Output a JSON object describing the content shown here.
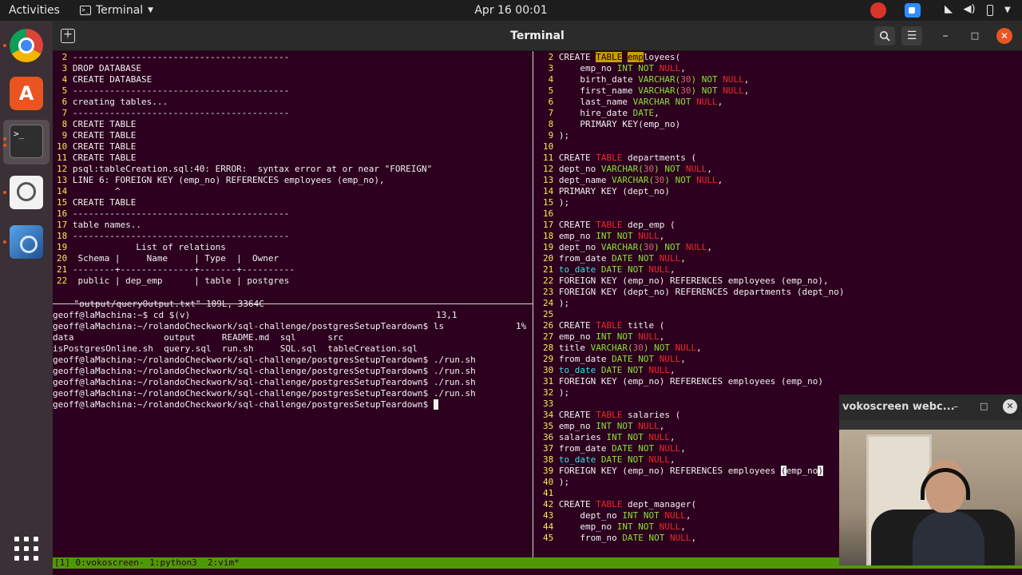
{
  "topbar": {
    "activities": "Activities",
    "app_menu": "Terminal",
    "clock": "Apr 16  00:01"
  },
  "window": {
    "title": "Terminal"
  },
  "colors": {
    "terminal_bg": "#2c001e",
    "line_number": "#fce94f",
    "keyword": "#ef2929",
    "type": "#8ae234",
    "ubuntu_orange": "#e95420",
    "tmux_bar": "#4e9a06"
  },
  "left_vim": {
    "lines": [
      {
        "n": " 2",
        "t": " -----------------------------------------"
      },
      {
        "n": " 3",
        "t": " DROP DATABASE"
      },
      {
        "n": " 4",
        "t": " CREATE DATABASE"
      },
      {
        "n": " 5",
        "t": " -----------------------------------------"
      },
      {
        "n": " 6",
        "t": " creating tables..."
      },
      {
        "n": " 7",
        "t": " -----------------------------------------"
      },
      {
        "n": " 8",
        "t": " CREATE TABLE"
      },
      {
        "n": " 9",
        "t": " CREATE TABLE"
      },
      {
        "n": "10",
        "t": " CREATE TABLE"
      },
      {
        "n": "11",
        "t": " CREATE TABLE"
      },
      {
        "n": "12",
        "t": " psql:tableCreation.sql:40: ERROR:  syntax error at or near \"FOREIGN\""
      },
      {
        "n": "13",
        "t": " LINE 6: FOREIGN KEY (emp_no) REFERENCES employees (emp_no),"
      },
      {
        "n": "14",
        "t": "         ^"
      },
      {
        "n": "15",
        "t": " CREATE TABLE"
      },
      {
        "n": "16",
        "t": " -----------------------------------------"
      },
      {
        "n": "17",
        "t": " table names.."
      },
      {
        "n": "18",
        "t": " -----------------------------------------"
      },
      {
        "n": "19",
        "t": "             List of relations"
      },
      {
        "n": "20",
        "t": "  Schema |     Name     | Type  |  Owner"
      },
      {
        "n": "21",
        "t": " --------+--------------+-------+----------"
      },
      {
        "n": "22",
        "t": "  public | dep_emp      | table | postgres"
      }
    ],
    "status_file": "\"output/queryOutput.txt\" 109L, 3364C",
    "status_pos": "13,1",
    "status_pct": "1%"
  },
  "shell": {
    "lines": [
      "geoff@laMachina:~$ cd $(v)",
      "geoff@laMachina:~/rolandoCheckwork/sql-challenge/postgresSetupTeardown$ ls",
      "data                 output     README.md  sql      src",
      "isPostgresOnline.sh  query.sql  run.sh     SQL.sql  tableCreation.sql",
      "geoff@laMachina:~/rolandoCheckwork/sql-challenge/postgresSetupTeardown$ ./run.sh",
      "geoff@laMachina:~/rolandoCheckwork/sql-challenge/postgresSetupTeardown$ ./run.sh",
      "geoff@laMachina:~/rolandoCheckwork/sql-challenge/postgresSetupTeardown$ ./run.sh",
      "geoff@laMachina:~/rolandoCheckwork/sql-challenge/postgresSetupTeardown$ ./run.sh",
      "geoff@laMachina:~/rolandoCheckwork/sql-challenge/postgresSetupTeardown$ "
    ]
  },
  "right_vim": {
    "lines": [
      {
        "n": " 2",
        "s": [
          [
            "kw2",
            "CREATE "
          ],
          [
            "hl",
            "TABLE"
          ],
          [
            "p",
            " "
          ],
          [
            "hl",
            "emp"
          ],
          [
            "p",
            "loyees("
          ]
        ]
      },
      {
        "n": " 3",
        "s": [
          [
            "p",
            "    emp_no "
          ],
          [
            "ty",
            "INT"
          ],
          [
            "p",
            " "
          ],
          [
            "ty",
            "NOT"
          ],
          [
            "p",
            " "
          ],
          [
            "kw",
            "NULL"
          ],
          [
            "p",
            ","
          ]
        ]
      },
      {
        "n": " 4",
        "s": [
          [
            "p",
            "    birth_date "
          ],
          [
            "ty",
            "VARCHAR("
          ],
          [
            "nm",
            "30"
          ],
          [
            "ty",
            ")"
          ],
          [
            "p",
            " "
          ],
          [
            "ty",
            "NOT"
          ],
          [
            "p",
            " "
          ],
          [
            "kw",
            "NULL"
          ],
          [
            "p",
            ","
          ]
        ]
      },
      {
        "n": " 5",
        "s": [
          [
            "p",
            "    first_name "
          ],
          [
            "ty",
            "VARCHAR("
          ],
          [
            "nm",
            "30"
          ],
          [
            "ty",
            ")"
          ],
          [
            "p",
            " "
          ],
          [
            "ty",
            "NOT"
          ],
          [
            "p",
            " "
          ],
          [
            "kw",
            "NULL"
          ],
          [
            "p",
            ","
          ]
        ]
      },
      {
        "n": " 6",
        "s": [
          [
            "p",
            "    last_name "
          ],
          [
            "ty",
            "VARCHAR"
          ],
          [
            "p",
            " "
          ],
          [
            "ty",
            "NOT"
          ],
          [
            "p",
            " "
          ],
          [
            "kw",
            "NULL"
          ],
          [
            "p",
            ","
          ]
        ]
      },
      {
        "n": " 7",
        "s": [
          [
            "p",
            "    hire_date "
          ],
          [
            "ty",
            "DATE"
          ],
          [
            "p",
            ","
          ]
        ]
      },
      {
        "n": " 8",
        "s": [
          [
            "p",
            "    PRIMARY KEY(emp_no)"
          ]
        ]
      },
      {
        "n": " 9",
        "s": [
          [
            "p",
            ");"
          ]
        ]
      },
      {
        "n": "10",
        "s": []
      },
      {
        "n": "11",
        "s": [
          [
            "p",
            "CREATE "
          ],
          [
            "kw",
            "TABLE"
          ],
          [
            "p",
            " departments ("
          ]
        ]
      },
      {
        "n": "12",
        "s": [
          [
            "p",
            "dept_no "
          ],
          [
            "ty",
            "VARCHAR("
          ],
          [
            "nm",
            "30"
          ],
          [
            "ty",
            ")"
          ],
          [
            "p",
            " "
          ],
          [
            "ty",
            "NOT"
          ],
          [
            "p",
            " "
          ],
          [
            "kw",
            "NULL"
          ],
          [
            "p",
            ","
          ]
        ]
      },
      {
        "n": "13",
        "s": [
          [
            "p",
            "dept_name "
          ],
          [
            "ty",
            "VARCHAR("
          ],
          [
            "nm",
            "30"
          ],
          [
            "ty",
            ")"
          ],
          [
            "p",
            " "
          ],
          [
            "ty",
            "NOT"
          ],
          [
            "p",
            " "
          ],
          [
            "kw",
            "NULL"
          ],
          [
            "p",
            ","
          ]
        ]
      },
      {
        "n": "14",
        "s": [
          [
            "p",
            "PRIMARY KEY (dept_no)"
          ]
        ]
      },
      {
        "n": "15",
        "s": [
          [
            "p",
            ");"
          ]
        ]
      },
      {
        "n": "16",
        "s": []
      },
      {
        "n": "17",
        "s": [
          [
            "p",
            "CREATE "
          ],
          [
            "kw",
            "TABLE"
          ],
          [
            "p",
            " dep_emp ("
          ]
        ]
      },
      {
        "n": "18",
        "s": [
          [
            "p",
            "emp_no "
          ],
          [
            "ty",
            "INT"
          ],
          [
            "p",
            " "
          ],
          [
            "ty",
            "NOT"
          ],
          [
            "p",
            " "
          ],
          [
            "kw",
            "NULL"
          ],
          [
            "p",
            ","
          ]
        ]
      },
      {
        "n": "19",
        "s": [
          [
            "p",
            "dept_no "
          ],
          [
            "ty",
            "VARCHAR("
          ],
          [
            "nm",
            "30"
          ],
          [
            "ty",
            ")"
          ],
          [
            "p",
            " "
          ],
          [
            "ty",
            "NOT"
          ],
          [
            "p",
            " "
          ],
          [
            "kw",
            "NULL"
          ],
          [
            "p",
            ","
          ]
        ]
      },
      {
        "n": "20",
        "s": [
          [
            "p",
            "from_date "
          ],
          [
            "ty",
            "DATE"
          ],
          [
            "p",
            " "
          ],
          [
            "ty",
            "NOT"
          ],
          [
            "p",
            " "
          ],
          [
            "kw",
            "NULL"
          ],
          [
            "p",
            ","
          ]
        ]
      },
      {
        "n": "21",
        "s": [
          [
            "td",
            "to_date"
          ],
          [
            "p",
            " "
          ],
          [
            "ty",
            "DATE"
          ],
          [
            "p",
            " "
          ],
          [
            "ty",
            "NOT"
          ],
          [
            "p",
            " "
          ],
          [
            "kw",
            "NULL"
          ],
          [
            "p",
            ","
          ]
        ]
      },
      {
        "n": "22",
        "s": [
          [
            "p",
            "FOREIGN KEY (emp_no) REFERENCES employees (emp_no),"
          ]
        ]
      },
      {
        "n": "23",
        "s": [
          [
            "p",
            "FOREIGN KEY (dept_no) REFERENCES departments (dept_no)"
          ]
        ]
      },
      {
        "n": "24",
        "s": [
          [
            "p",
            ");"
          ]
        ]
      },
      {
        "n": "25",
        "s": []
      },
      {
        "n": "26",
        "s": [
          [
            "p",
            "CREATE "
          ],
          [
            "kw",
            "TABLE"
          ],
          [
            "p",
            " title ("
          ]
        ]
      },
      {
        "n": "27",
        "s": [
          [
            "p",
            "emp_no "
          ],
          [
            "ty",
            "INT"
          ],
          [
            "p",
            " "
          ],
          [
            "ty",
            "NOT"
          ],
          [
            "p",
            " "
          ],
          [
            "kw",
            "NULL"
          ],
          [
            "p",
            ","
          ]
        ]
      },
      {
        "n": "28",
        "s": [
          [
            "p",
            "title "
          ],
          [
            "ty",
            "VARCHAR("
          ],
          [
            "nm",
            "30"
          ],
          [
            "ty",
            ")"
          ],
          [
            "p",
            " "
          ],
          [
            "ty",
            "NOT"
          ],
          [
            "p",
            " "
          ],
          [
            "kw",
            "NULL"
          ],
          [
            "p",
            ","
          ]
        ]
      },
      {
        "n": "29",
        "s": [
          [
            "p",
            "from_date "
          ],
          [
            "ty",
            "DATE"
          ],
          [
            "p",
            " "
          ],
          [
            "ty",
            "NOT"
          ],
          [
            "p",
            " "
          ],
          [
            "kw",
            "NULL"
          ],
          [
            "p",
            ","
          ]
        ]
      },
      {
        "n": "30",
        "s": [
          [
            "td",
            "to_date"
          ],
          [
            "p",
            " "
          ],
          [
            "ty",
            "DATE"
          ],
          [
            "p",
            " "
          ],
          [
            "ty",
            "NOT"
          ],
          [
            "p",
            " "
          ],
          [
            "kw",
            "NULL"
          ],
          [
            "p",
            ","
          ]
        ]
      },
      {
        "n": "31",
        "s": [
          [
            "p",
            "FOREIGN KEY (emp_no) REFERENCES employees (emp_no)"
          ]
        ]
      },
      {
        "n": "32",
        "s": [
          [
            "p",
            ");"
          ]
        ]
      },
      {
        "n": "33",
        "s": []
      },
      {
        "n": "34",
        "s": [
          [
            "p",
            "CREATE "
          ],
          [
            "kw",
            "TABLE"
          ],
          [
            "p",
            " salaries ("
          ]
        ]
      },
      {
        "n": "35",
        "s": [
          [
            "p",
            "emp_no "
          ],
          [
            "ty",
            "INT"
          ],
          [
            "p",
            " "
          ],
          [
            "ty",
            "NOT"
          ],
          [
            "p",
            " "
          ],
          [
            "kw",
            "NULL"
          ],
          [
            "p",
            ","
          ]
        ]
      },
      {
        "n": "36",
        "s": [
          [
            "p",
            "salaries "
          ],
          [
            "ty",
            "INT"
          ],
          [
            "p",
            " "
          ],
          [
            "ty",
            "NOT"
          ],
          [
            "p",
            " "
          ],
          [
            "kw",
            "NULL"
          ],
          [
            "p",
            ","
          ]
        ]
      },
      {
        "n": "37",
        "s": [
          [
            "p",
            "from_date "
          ],
          [
            "ty",
            "DATE"
          ],
          [
            "p",
            " "
          ],
          [
            "ty",
            "NOT"
          ],
          [
            "p",
            " "
          ],
          [
            "kw",
            "NULL"
          ],
          [
            "p",
            ","
          ]
        ]
      },
      {
        "n": "38",
        "s": [
          [
            "td",
            "to_date"
          ],
          [
            "p",
            " "
          ],
          [
            "ty",
            "DATE"
          ],
          [
            "p",
            " "
          ],
          [
            "ty",
            "NOT"
          ],
          [
            "p",
            " "
          ],
          [
            "kw",
            "NULL"
          ],
          [
            "p",
            ","
          ]
        ]
      },
      {
        "n": "39",
        "s": [
          [
            "p",
            "FOREIGN KEY (emp_no) REFERENCES employees "
          ],
          [
            "cur",
            "("
          ],
          [
            "p",
            "emp_no"
          ],
          [
            "cur",
            ")"
          ]
        ]
      },
      {
        "n": "40",
        "s": [
          [
            "p",
            ");"
          ]
        ]
      },
      {
        "n": "41",
        "s": []
      },
      {
        "n": "42",
        "s": [
          [
            "p",
            "CREATE "
          ],
          [
            "kw",
            "TABLE"
          ],
          [
            "p",
            " dept_manager("
          ]
        ]
      },
      {
        "n": "43",
        "s": [
          [
            "p",
            "    dept_no "
          ],
          [
            "ty",
            "INT"
          ],
          [
            "p",
            " "
          ],
          [
            "ty",
            "NOT"
          ],
          [
            "p",
            " "
          ],
          [
            "kw",
            "NULL"
          ],
          [
            "p",
            ","
          ]
        ]
      },
      {
        "n": "44",
        "s": [
          [
            "p",
            "    emp_no "
          ],
          [
            "ty",
            "INT"
          ],
          [
            "p",
            " "
          ],
          [
            "ty",
            "NOT"
          ],
          [
            "p",
            " "
          ],
          [
            "kw",
            "NULL"
          ],
          [
            "p",
            ","
          ]
        ]
      },
      {
        "n": "45",
        "s": [
          [
            "p",
            "    from_no "
          ],
          [
            "ty",
            "DATE"
          ],
          [
            "p",
            " "
          ],
          [
            "ty",
            "NOT"
          ],
          [
            "p",
            " "
          ],
          [
            "kw",
            "NULL"
          ],
          [
            "p",
            ","
          ]
        ]
      }
    ]
  },
  "tmux": {
    "status": "[1] 0:vokoscreen- 1:python3  2:vim*"
  },
  "vokoscreen": {
    "title": "vokoscreen webc..."
  },
  "icons": {
    "new_tab": "new-tab-icon",
    "search": "search-icon",
    "hamburger": "hamburger-menu-icon",
    "minimize": "minimize-icon",
    "maximize": "maximize-icon",
    "close": "close-icon"
  }
}
